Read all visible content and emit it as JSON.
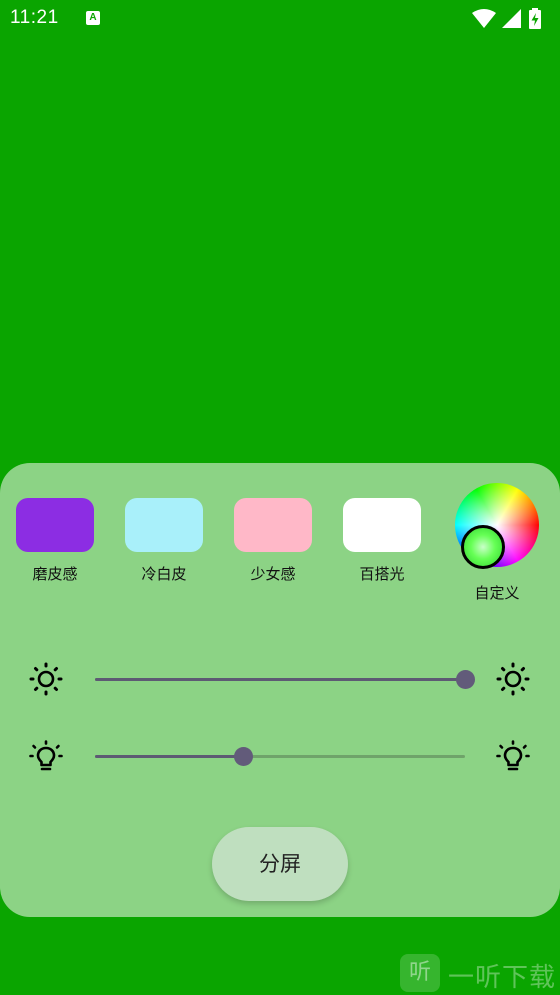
{
  "status_bar": {
    "time": "11:21",
    "notification_icon": "A",
    "icons": [
      "wifi-icon",
      "signal-icon",
      "battery-charging-icon"
    ]
  },
  "background_color": "#0aa500",
  "panel": {
    "background": "#8cd385",
    "presets": [
      {
        "label": "磨皮感",
        "color": "#8c2de3"
      },
      {
        "label": "冷白皮",
        "color": "#a9f0fa"
      },
      {
        "label": "少女感",
        "color": "#ffb8c8"
      },
      {
        "label": "百搭光",
        "color": "#ffffff"
      }
    ],
    "custom": {
      "label": "自定义",
      "icon": "color-wheel-icon"
    },
    "sliders": [
      {
        "name": "brightness",
        "icon_left": "sun-icon",
        "icon_right": "sun-icon",
        "level_percent": 100
      },
      {
        "name": "light-intensity",
        "icon_left": "lightbulb-icon",
        "icon_right": "lightbulb-icon",
        "level_percent": 40
      }
    ],
    "split_button_label": "分屏"
  },
  "watermark": {
    "logo": "听",
    "text": "一听下载"
  }
}
